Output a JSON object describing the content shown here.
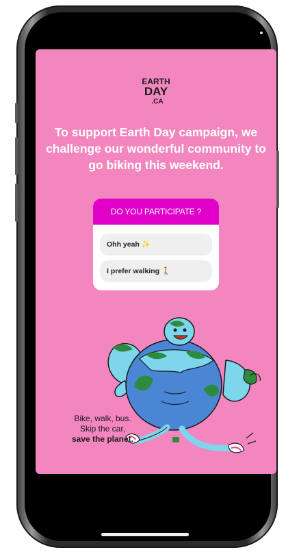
{
  "brand": {
    "logo_lines": [
      "EARTH",
      "DAY",
      ".CA"
    ]
  },
  "headline": "To support Earth Day campaign, we challenge our wonderful community to go biking this weekend.",
  "poll": {
    "question": "DO YOU PARTICIPATE ?",
    "options": [
      {
        "label": "Ohh yeah",
        "emoji": "✨"
      },
      {
        "label": "I prefer walking",
        "emoji": "🚶"
      }
    ]
  },
  "tagline": {
    "line1": "Bike, walk, bus.",
    "line2": "Skip the car,",
    "line3": "save the planet."
  },
  "colors": {
    "story_background": "#f386be",
    "poll_header": "#e000c8",
    "option_background": "#efefef"
  },
  "icons": {
    "illustration": "earth-character-running-icon"
  }
}
